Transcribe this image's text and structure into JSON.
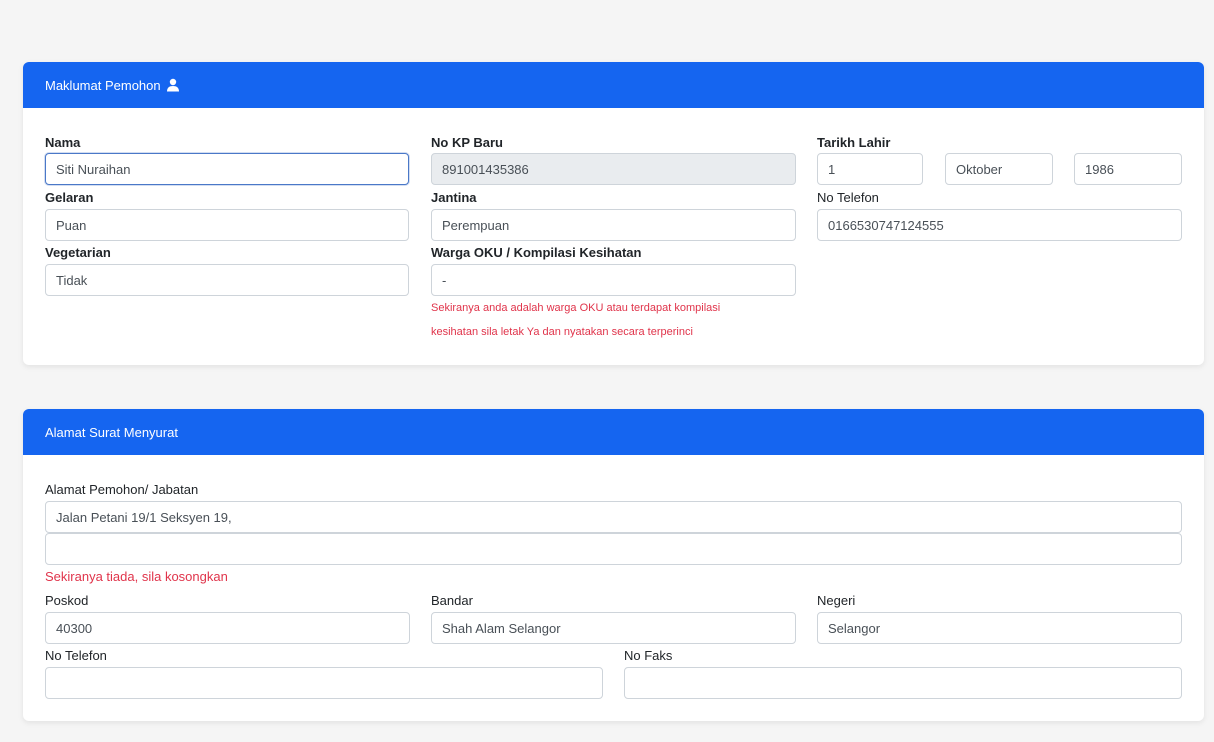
{
  "applicant": {
    "header": "Maklumat Pemohon",
    "name": {
      "label": "Nama",
      "value": "Siti Nuraihan"
    },
    "ic": {
      "label": "No KP Baru",
      "value": "891001435386"
    },
    "dob": {
      "label": "Tarikh Lahir",
      "day": "1",
      "month": "Oktober",
      "year": "1986"
    },
    "title": {
      "label": "Gelaran",
      "value": "Puan"
    },
    "gender": {
      "label": "Jantina",
      "value": "Perempuan"
    },
    "phone": {
      "label": "No Telefon",
      "value": "0166530747124555"
    },
    "vegetarian": {
      "label": "Vegetarian",
      "value": "Tidak"
    },
    "oku": {
      "label": "Warga OKU / Kompilasi Kesihatan",
      "value": "-",
      "note_line1": "Sekiranya anda adalah warga OKU atau terdapat kompilasi",
      "note_line2": "kesihatan sila letak Ya dan nyatakan secara terperinci"
    }
  },
  "address": {
    "header": "Alamat Surat Menyurat",
    "address_label": "Alamat Pemohon/ Jabatan",
    "line1": "Jalan Petani 19/1 Seksyen 19,",
    "line2": "",
    "line2_note": "Sekiranya tiada, sila kosongkan",
    "postcode": {
      "label": "Poskod",
      "value": "40300"
    },
    "city": {
      "label": "Bandar",
      "value": "Shah Alam Selangor"
    },
    "state": {
      "label": "Negeri",
      "value": "Selangor"
    },
    "phone": {
      "label": "No Telefon",
      "value": ""
    },
    "fax": {
      "label": "No Faks",
      "value": ""
    }
  }
}
